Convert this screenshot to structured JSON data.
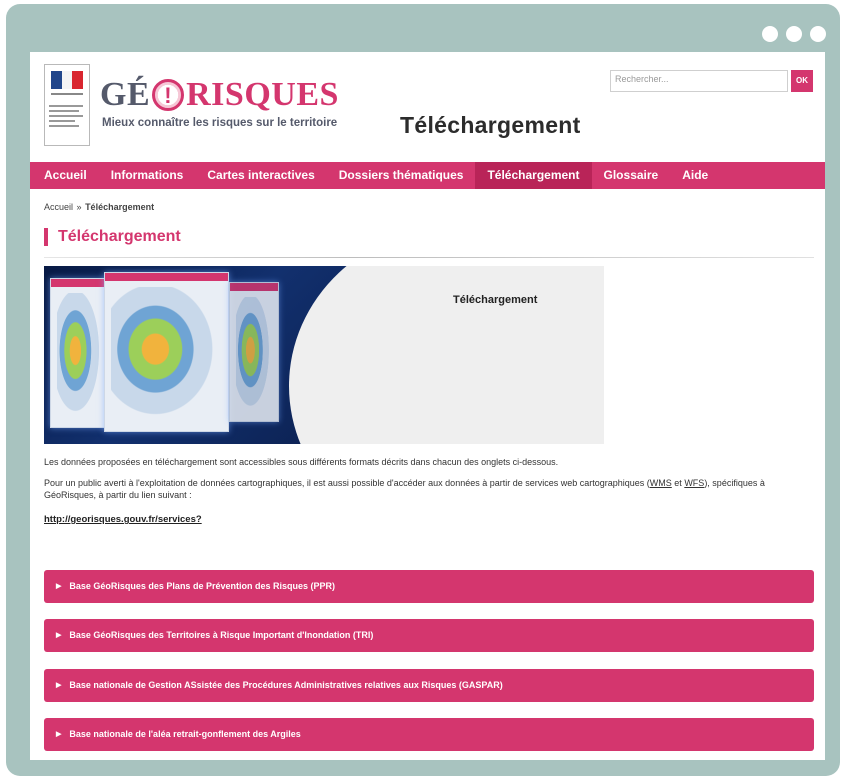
{
  "header": {
    "logo_ge": "GÉ",
    "logo_risques": "RISQUES",
    "logo_icon": "!",
    "tagline": "Mieux connaître les risques sur le territoire",
    "site_title": "Téléchargement",
    "search_placeholder": "Rechercher...",
    "search_button": "OK"
  },
  "nav": {
    "items": [
      {
        "label": "Accueil",
        "active": false
      },
      {
        "label": "Informations",
        "active": false
      },
      {
        "label": "Cartes interactives",
        "active": false
      },
      {
        "label": "Dossiers thématiques",
        "active": false
      },
      {
        "label": "Téléchargement",
        "active": true
      },
      {
        "label": "Glossaire",
        "active": false
      },
      {
        "label": "Aide",
        "active": false
      }
    ]
  },
  "breadcrumb": {
    "home": "Accueil",
    "separator": "»",
    "current": "Téléchargement"
  },
  "page_heading": "Téléchargement",
  "banner": {
    "title": "Téléchargement"
  },
  "intro": {
    "line1": "Les données proposées en téléchargement sont accessibles sous différents formats décrits dans chacun des onglets ci-dessous.",
    "line2_part1": "Pour un public averti à l'exploitation de données cartographiques, il est aussi possible d'accéder aux données à partir de services web cartographiques (",
    "wms": "WMS",
    "and": " et ",
    "wfs": "WFS",
    "line2_part2": "), spécifiques à GéoRisques, à partir du lien suivant :",
    "services_link": "http://georisques.gouv.fr/services?"
  },
  "accordions": [
    {
      "label": "Base GéoRisques des Plans de Prévention des Risques (PPR)"
    },
    {
      "label": "Base GéoRisques des Territoires à Risque Important d'Inondation (TRI)"
    },
    {
      "label": "Base nationale de Gestion ASsistée des Procédures Administratives relatives aux Risques (GASPAR)"
    },
    {
      "label": "Base nationale de l'aléa retrait-gonflement des Argiles"
    }
  ],
  "colors": {
    "frame": "#a8c3bf",
    "accent": "#d4366e",
    "nav_active": "#b92458"
  },
  "icons": {
    "window_dots": "more-dots-icon",
    "accordion_caret": "caret-right-icon"
  }
}
